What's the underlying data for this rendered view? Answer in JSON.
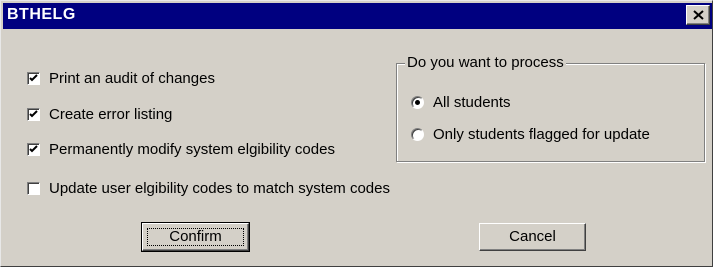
{
  "window": {
    "title": "BTHELG",
    "close_glyph": "×"
  },
  "options": [
    {
      "label": "Print an audit of changes",
      "checked": true
    },
    {
      "label": "Create error listing",
      "checked": true
    },
    {
      "label": "Permanently modify system elgibility codes",
      "checked": true
    },
    {
      "label": "Update user elgibility codes to match system codes",
      "checked": false
    }
  ],
  "process_group": {
    "legend": "Do you want to process",
    "options": [
      {
        "label": "All students",
        "selected": true
      },
      {
        "label": "Only students flagged for update",
        "selected": false
      }
    ]
  },
  "buttons": {
    "confirm_label": "Confirm",
    "cancel_label": "Cancel"
  },
  "colors": {
    "titlebar": "#000080",
    "face": "#d4d0c8"
  }
}
